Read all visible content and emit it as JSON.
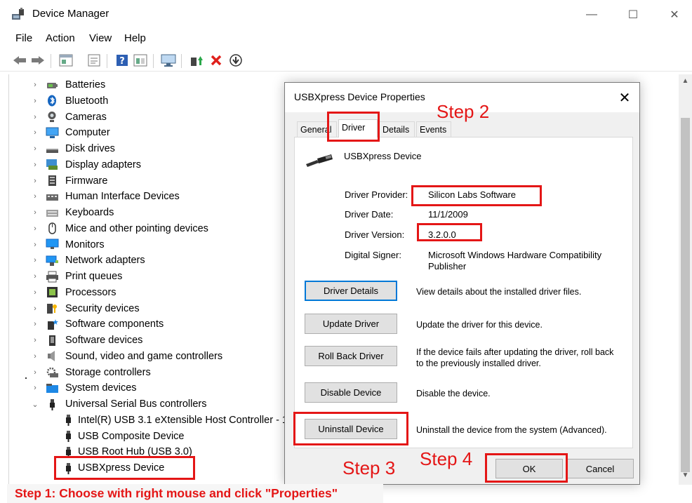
{
  "window": {
    "title": "Device Manager",
    "minimize_glyph": "—",
    "maximize_glyph": "☐",
    "close_glyph": "✕"
  },
  "menu": [
    "File",
    "Action",
    "View",
    "Help"
  ],
  "toolbar": {
    "icons": [
      "back-arrow-icon",
      "forward-arrow-icon",
      "properties-icon",
      "show-hide-icon",
      "help-icon",
      "view-icon",
      "monitor-icon",
      "update-driver-icon",
      "uninstall-icon",
      "download-icon"
    ]
  },
  "tree": {
    "categories": [
      {
        "label": "Batteries",
        "icon": "battery-icon",
        "chevron": "›"
      },
      {
        "label": "Bluetooth",
        "icon": "bluetooth-icon",
        "chevron": "›"
      },
      {
        "label": "Cameras",
        "icon": "camera-icon",
        "chevron": "›"
      },
      {
        "label": "Computer",
        "icon": "computer-icon",
        "chevron": "›"
      },
      {
        "label": "Disk drives",
        "icon": "disk-drive-icon",
        "chevron": "›"
      },
      {
        "label": "Display adapters",
        "icon": "display-adapter-icon",
        "chevron": "›"
      },
      {
        "label": "Firmware",
        "icon": "firmware-icon",
        "chevron": "›"
      },
      {
        "label": "Human Interface Devices",
        "icon": "hid-icon",
        "chevron": "›"
      },
      {
        "label": "Keyboards",
        "icon": "keyboard-icon",
        "chevron": "›"
      },
      {
        "label": "Mice and other pointing devices",
        "icon": "mouse-icon",
        "chevron": "›"
      },
      {
        "label": "Monitors",
        "icon": "monitor-icon",
        "chevron": "›"
      },
      {
        "label": "Network adapters",
        "icon": "network-adapter-icon",
        "chevron": "›"
      },
      {
        "label": "Print queues",
        "icon": "printer-icon",
        "chevron": "›"
      },
      {
        "label": "Processors",
        "icon": "processor-icon",
        "chevron": "›"
      },
      {
        "label": "Security devices",
        "icon": "security-device-icon",
        "chevron": "›"
      },
      {
        "label": "Software components",
        "icon": "software-component-icon",
        "chevron": "›"
      },
      {
        "label": "Software devices",
        "icon": "software-device-icon",
        "chevron": "›"
      },
      {
        "label": "Sound, video and game controllers",
        "icon": "speaker-icon",
        "chevron": "›"
      },
      {
        "label": "Storage controllers",
        "icon": "storage-controller-icon",
        "chevron": "›"
      },
      {
        "label": "System devices",
        "icon": "system-device-icon",
        "chevron": "›"
      },
      {
        "label": "Universal Serial Bus controllers",
        "icon": "usb-icon",
        "chevron": "⌄"
      }
    ],
    "usb_children": [
      "Intel(R) USB 3.1 eXtensible Host Controller - 1",
      "USB Composite Device",
      "USB Root Hub (USB 3.0)",
      "USBXpress Device"
    ]
  },
  "dialog": {
    "title": "USBXpress Device Properties",
    "close_glyph": "✕",
    "tabs": [
      "General",
      "Driver",
      "Details",
      "Events"
    ],
    "active_tab": "Driver",
    "device_name": "USBXpress Device",
    "properties": [
      {
        "label": "Driver Provider:",
        "value": "Silicon Labs Software"
      },
      {
        "label": "Driver Date:",
        "value": "11/1/2009"
      },
      {
        "label": "Driver Version:",
        "value": "3.2.0.0"
      },
      {
        "label": "Digital Signer:",
        "value": "Microsoft Windows Hardware Compatibility Publisher"
      }
    ],
    "actions": [
      {
        "button": "Driver Details",
        "description": "View details about the installed driver files."
      },
      {
        "button": "Update Driver",
        "description": "Update the driver for this device."
      },
      {
        "button": "Roll Back Driver",
        "description": "If the device fails after updating the driver, roll back to the previously installed driver."
      },
      {
        "button": "Disable Device",
        "description": "Disable the device."
      },
      {
        "button": "Uninstall Device",
        "description": "Uninstall the device from the system (Advanced)."
      }
    ],
    "ok_label": "OK",
    "cancel_label": "Cancel"
  },
  "annotations": {
    "step1": "Step 1: Choose with right mouse and click \"Properties\"",
    "step2": "Step 2",
    "step3": "Step 3",
    "step4": "Step 4",
    "color": "#e41616"
  }
}
